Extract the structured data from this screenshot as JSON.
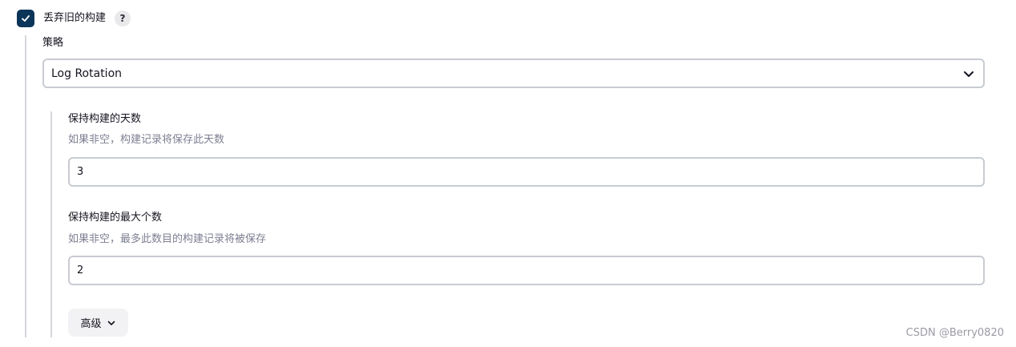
{
  "discard": {
    "checked": true,
    "label": "丢弃旧的构建",
    "help_text": "?"
  },
  "strategy": {
    "label": "策略",
    "selected": "Log Rotation"
  },
  "days_to_keep": {
    "label": "保持构建的天数",
    "description": "如果非空，构建记录将保存此天数",
    "value": "3"
  },
  "num_to_keep": {
    "label": "保持构建的最大个数",
    "description": "如果非空，最多此数目的构建记录将被保存",
    "value": "2"
  },
  "advanced": {
    "label": "高级"
  },
  "watermark": "CSDN @Berry0820",
  "colors": {
    "checkbox_bg": "#0b3558",
    "border": "#c8cbd1",
    "description_text": "#7d7f92"
  }
}
